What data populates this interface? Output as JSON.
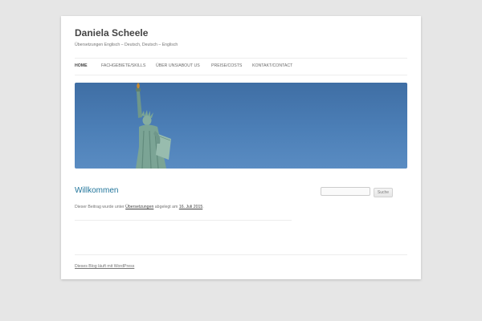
{
  "site": {
    "title": "Daniela Scheele",
    "description": "Übersetzungen Englisch – Deutsch, Deutsch – Englisch"
  },
  "nav": {
    "items": [
      {
        "label": "HOME"
      },
      {
        "label": "FACHGEBIETE/SKILLS"
      },
      {
        "label": "ÜBER UNS/ABOUT US"
      },
      {
        "label": "PREISE/COSTS"
      },
      {
        "label": "KONTAKT/CONTACT"
      }
    ]
  },
  "post": {
    "title": "Willkommen",
    "meta_prefix": "Dieser Beitrag wurde unter",
    "category": "Übersetzungen",
    "meta_middle": "abgelegt am",
    "date": "16. Juli 2015",
    "meta_suffix": "."
  },
  "search": {
    "placeholder": "",
    "button_label": "Suche"
  },
  "footer": {
    "credit": "Dieses Blog läuft mit WordPress"
  },
  "colors": {
    "background": "#e6e6e6",
    "link": "#21759b",
    "sky": "#4c7fb7"
  }
}
